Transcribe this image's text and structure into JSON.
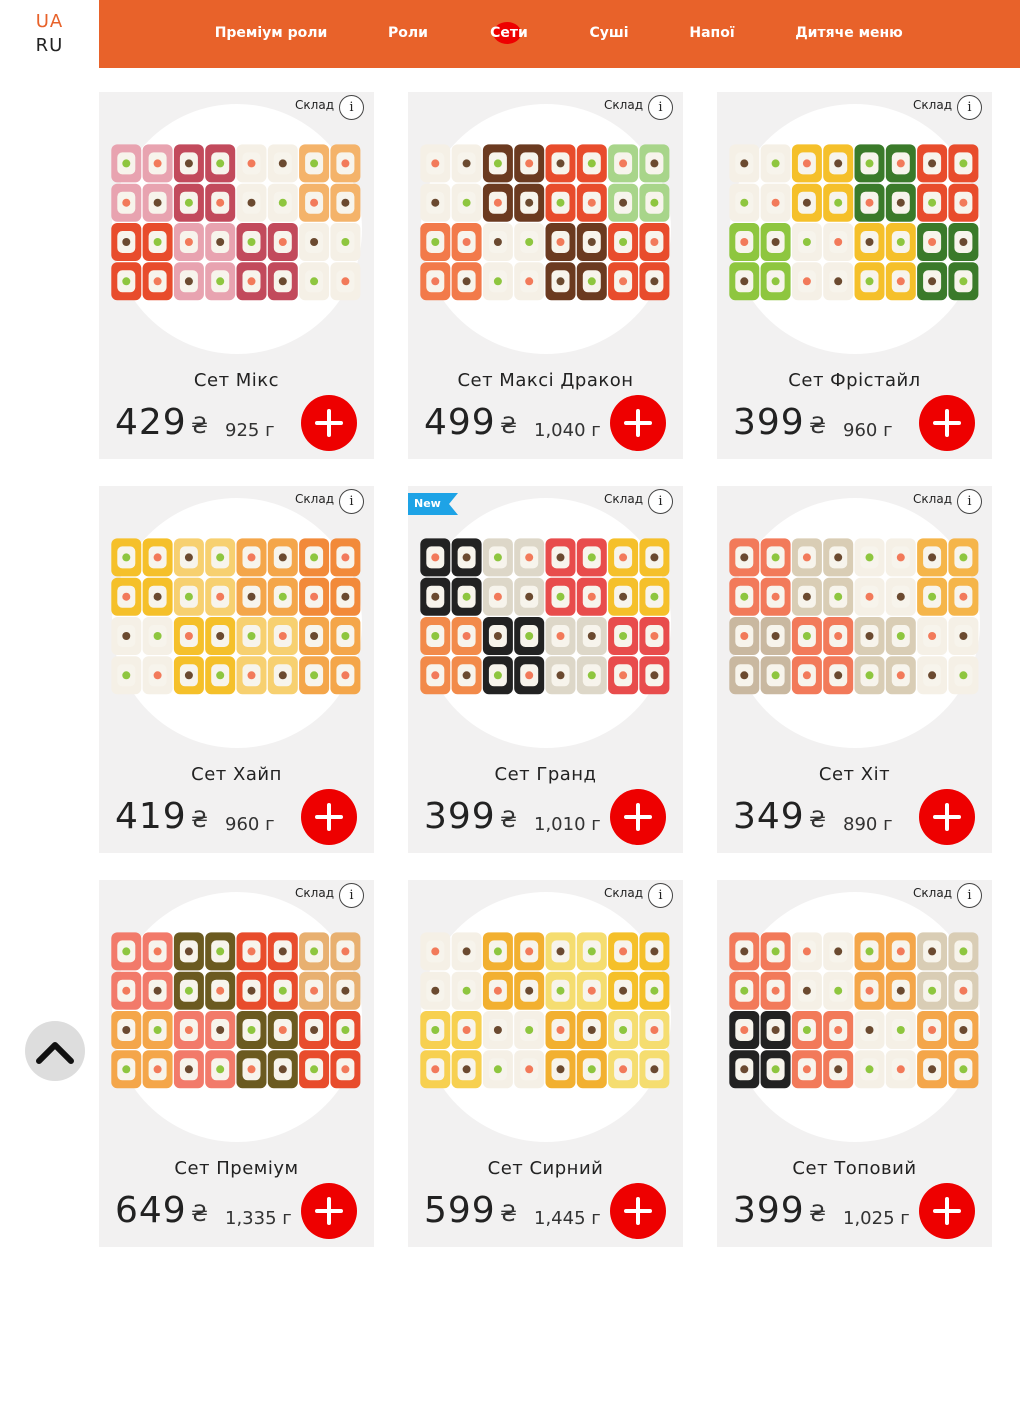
{
  "lang": {
    "ua": "UA",
    "ru": "RU"
  },
  "nav": [
    {
      "label": "Преміум роли",
      "active": false
    },
    {
      "label": "Роли",
      "active": false
    },
    {
      "label": "Сети",
      "active": true
    },
    {
      "label": "Суші",
      "active": false
    },
    {
      "label": "Напої",
      "active": false
    },
    {
      "label": "Дитяче меню",
      "active": false
    }
  ],
  "info_label": "Склад",
  "info_icon": "i",
  "currency": "₴",
  "products": [
    {
      "name": "Сет Мікс",
      "price": "429",
      "weight": "925 г",
      "badge": "",
      "colors": [
        "#e8a3b0",
        "#c24a5c",
        "#f5f0e6",
        "#f4b36a",
        "#e84c2c"
      ]
    },
    {
      "name": "Сет Максі Дракон",
      "price": "499",
      "weight": "1,040 г",
      "badge": "",
      "colors": [
        "#f27a4a",
        "#f5f0e6",
        "#6b3a20",
        "#e84c2c",
        "#a8d58a"
      ]
    },
    {
      "name": "Сет Фрістайл",
      "price": "399",
      "weight": "960 г",
      "badge": "",
      "colors": [
        "#e84c2c",
        "#8ec63f",
        "#f5f0e6",
        "#f5c02a",
        "#3a7a2a"
      ]
    },
    {
      "name": "Сет Хайп",
      "price": "419",
      "weight": "960 г",
      "badge": "",
      "colors": [
        "#f4a64a",
        "#f28a3a",
        "#f5f0e6",
        "#f5c02a",
        "#f7d070"
      ]
    },
    {
      "name": "Сет Гранд",
      "price": "399",
      "weight": "1,010 г",
      "badge": "New",
      "colors": [
        "#ddd7c8",
        "#e84c4c",
        "#f5c02a",
        "#f28a4a",
        "#222222"
      ]
    },
    {
      "name": "Сет Хіт",
      "price": "349",
      "weight": "890 г",
      "badge": "",
      "colors": [
        "#f27a5a",
        "#d9cdb5",
        "#f5f0e6",
        "#f5b54a",
        "#c9b8a0"
      ]
    },
    {
      "name": "Сет Преміум",
      "price": "649",
      "weight": "1,335 г",
      "badge": "",
      "colors": [
        "#f4a64a",
        "#f27a6a",
        "#6b5a20",
        "#e84c2c",
        "#e8b070"
      ]
    },
    {
      "name": "Сет Сирний",
      "price": "599",
      "weight": "1,445 г",
      "badge": "",
      "colors": [
        "#f5c02a",
        "#f7d050",
        "#f5f0e6",
        "#f2b030",
        "#f5dd70"
      ]
    },
    {
      "name": "Сет Топовий",
      "price": "399",
      "weight": "1,025 г",
      "badge": "",
      "colors": [
        "#f4a64a",
        "#d9cdb5",
        "#222222",
        "#f27a5a",
        "#f5f0e6"
      ]
    }
  ]
}
